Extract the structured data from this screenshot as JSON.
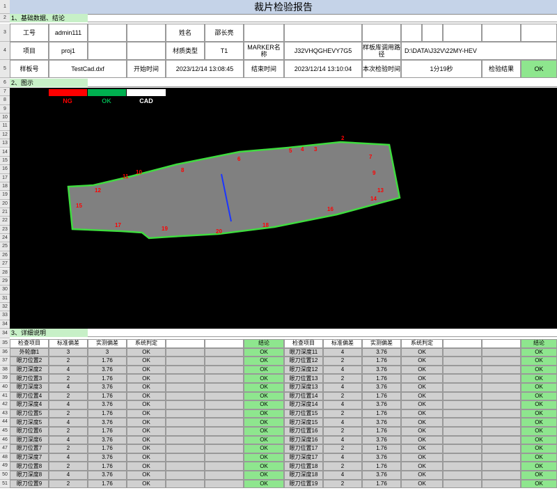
{
  "title": "裁片检验报告",
  "row_numbers": [
    "1",
    "2",
    "3",
    "4",
    "5",
    "6",
    "7",
    "8",
    "9",
    "10",
    "11",
    "12",
    "13",
    "14",
    "15",
    "16",
    "17",
    "18",
    "19",
    "20",
    "21",
    "22",
    "23",
    "24",
    "25",
    "26",
    "27",
    "28",
    "29",
    "30",
    "31",
    "32",
    "33",
    "34",
    "35",
    "36",
    "37",
    "38",
    "39",
    "40",
    "41",
    "42",
    "43",
    "44",
    "45",
    "46",
    "47",
    "48",
    "49",
    "50",
    "51"
  ],
  "section1": "1、基础数据、结论",
  "section2": "2、图示",
  "section3": "3、详细说明",
  "info": {
    "worker_label": "工号",
    "worker_value": "admin111",
    "name_label": "姓名",
    "name_value": "邵长亮",
    "item_label": "项目",
    "item_value": "proj1",
    "material_label": "材质类型",
    "material_value": "T1",
    "marker_label": "MARKER名称",
    "marker_value": "J32VHQGHEVY7G5",
    "library_label": "样板库调用路径",
    "library_value": "D:\\DATA\\J32V\\22MY-HEV",
    "sample_label": "样板号",
    "sample_value": "TestCad.dxf",
    "start_label": "开始时间",
    "start_value": "2023/12/14 13:08:45",
    "end_label": "结束时间",
    "end_value": "2023/12/14 13:10:04",
    "duration_label": "本次检验时间",
    "duration_value": "1分19秒",
    "result_label": "检验结果",
    "result_value": "OK"
  },
  "legend": {
    "ng": "NG",
    "ok": "OK",
    "cad": "CAD",
    "ng_color": "#ff0000",
    "ok_color": "#00b050",
    "cad_color": "#ffffff"
  },
  "markers": [
    "2",
    "4",
    "5",
    "3",
    "6",
    "7",
    "8",
    "9",
    "10",
    "11",
    "12",
    "13",
    "14",
    "15",
    "16",
    "17",
    "18",
    "19",
    "20"
  ],
  "table": {
    "headers_left": [
      "检查项目",
      "标准偏差",
      "实测偏差",
      "系统判定",
      "",
      "",
      "结论"
    ],
    "headers_right": [
      "检查项目",
      "标准偏差",
      "实测偏差",
      "系统判定",
      "",
      "",
      "结论"
    ],
    "left_rows": [
      [
        "外轮廓1",
        "3",
        "3",
        "OK",
        "OK"
      ],
      [
        "眼刀位置2",
        "2",
        "1.76",
        "OK",
        "OK"
      ],
      [
        "眼刀深度2",
        "4",
        "3.76",
        "OK",
        "OK"
      ],
      [
        "眼刀位置3",
        "2",
        "1.76",
        "OK",
        "OK"
      ],
      [
        "眼刀深度3",
        "4",
        "3.76",
        "OK",
        "OK"
      ],
      [
        "眼刀位置4",
        "2",
        "1.76",
        "OK",
        "OK"
      ],
      [
        "眼刀深度4",
        "4",
        "3.76",
        "OK",
        "OK"
      ],
      [
        "眼刀位置5",
        "2",
        "1.76",
        "OK",
        "OK"
      ],
      [
        "眼刀深度5",
        "4",
        "3.76",
        "OK",
        "OK"
      ],
      [
        "眼刀位置6",
        "2",
        "1.76",
        "OK",
        "OK"
      ],
      [
        "眼刀深度6",
        "4",
        "3.76",
        "OK",
        "OK"
      ],
      [
        "眼刀位置7",
        "2",
        "1.76",
        "OK",
        "OK"
      ],
      [
        "眼刀深度7",
        "4",
        "3.76",
        "OK",
        "OK"
      ],
      [
        "眼刀位置8",
        "2",
        "1.76",
        "OK",
        "OK"
      ],
      [
        "眼刀深度8",
        "4",
        "3.76",
        "OK",
        "OK"
      ],
      [
        "眼刀位置9",
        "2",
        "1.76",
        "OK",
        "OK"
      ]
    ],
    "right_rows": [
      [
        "眼刀深度11",
        "4",
        "3.76",
        "OK",
        "OK"
      ],
      [
        "眼刀位置12",
        "2",
        "1.76",
        "OK",
        "OK"
      ],
      [
        "眼刀深度12",
        "4",
        "3.76",
        "OK",
        "OK"
      ],
      [
        "眼刀位置13",
        "2",
        "1.76",
        "OK",
        "OK"
      ],
      [
        "眼刀深度13",
        "4",
        "3.76",
        "OK",
        "OK"
      ],
      [
        "眼刀位置14",
        "2",
        "1.76",
        "OK",
        "OK"
      ],
      [
        "眼刀深度14",
        "4",
        "3.76",
        "OK",
        "OK"
      ],
      [
        "眼刀位置15",
        "2",
        "1.76",
        "OK",
        "OK"
      ],
      [
        "眼刀深度15",
        "4",
        "3.76",
        "OK",
        "OK"
      ],
      [
        "眼刀位置16",
        "2",
        "1.76",
        "OK",
        "OK"
      ],
      [
        "眼刀深度16",
        "4",
        "3.76",
        "OK",
        "OK"
      ],
      [
        "眼刀位置17",
        "2",
        "1.76",
        "OK",
        "OK"
      ],
      [
        "眼刀深度17",
        "4",
        "3.76",
        "OK",
        "OK"
      ],
      [
        "眼刀位置18",
        "2",
        "1.76",
        "OK",
        "OK"
      ],
      [
        "眼刀深度18",
        "4",
        "3.76",
        "OK",
        "OK"
      ],
      [
        "眼刀位置19",
        "2",
        "1.76",
        "OK",
        "OK"
      ]
    ]
  }
}
